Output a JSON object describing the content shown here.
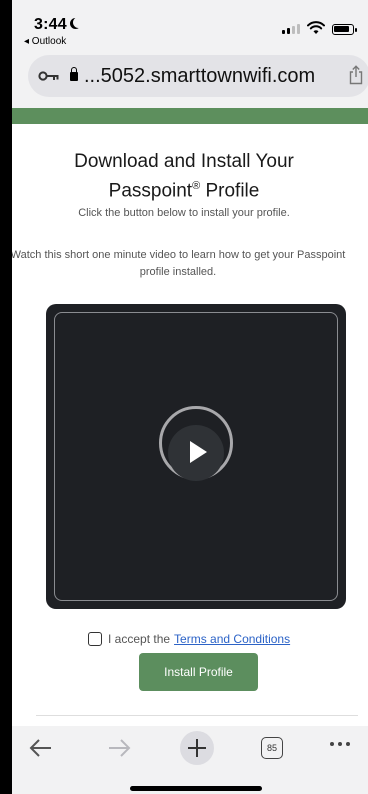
{
  "status_bar": {
    "time": "3:44",
    "back_app": "◂ Outlook"
  },
  "browser": {
    "url": "...5052.smarttownwifi.com",
    "tab_count": "85"
  },
  "content": {
    "title_line1": "Download and Install Your",
    "title_line2_pre": "Passpoint",
    "title_reg": "®",
    "title_line2_post": " Profile",
    "subtitle": "Click the button below to install your profile.",
    "video_text": "Watch this short one minute video to learn how to get your Passpoint profile installed.",
    "accept_label": "I accept the",
    "terms_link": "Terms and Conditions",
    "checkbox_checked": false,
    "install_button": "Install Profile"
  },
  "colors": {
    "accent_green": "#5c8e5e",
    "link_blue": "#2c63c7"
  },
  "icons": [
    "moon-icon",
    "signal-icon",
    "wifi-icon",
    "battery-icon",
    "key-icon",
    "lock-icon",
    "share-icon",
    "play-icon",
    "back-arrow-icon",
    "forward-arrow-icon",
    "plus-icon",
    "tabs-icon",
    "more-icon"
  ]
}
